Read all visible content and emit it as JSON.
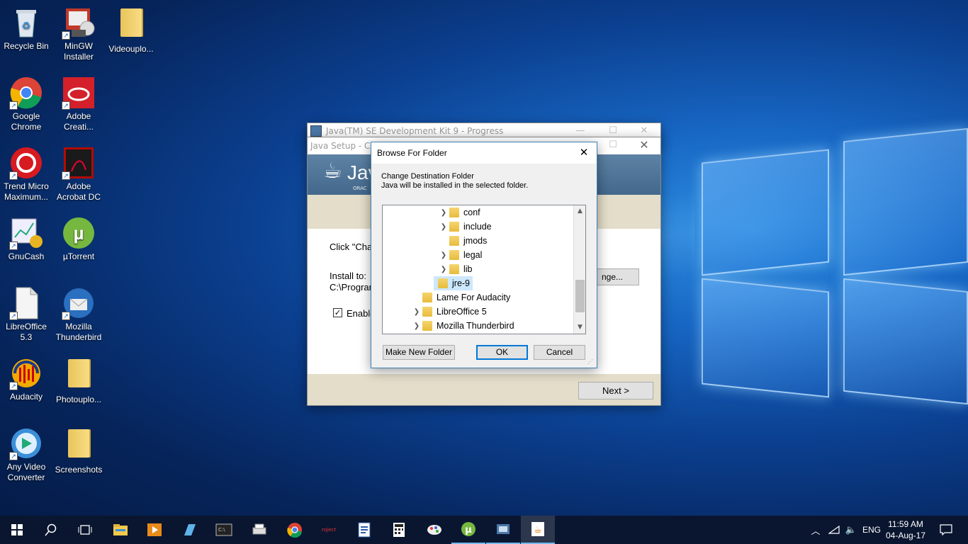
{
  "desktop": {
    "icons": [
      {
        "label1": "Recycle Bin",
        "label2": ""
      },
      {
        "label1": "MinGW",
        "label2": "Installer"
      },
      {
        "label1": "Videouplo...",
        "label2": ""
      },
      {
        "label1": "Google",
        "label2": "Chrome"
      },
      {
        "label1": "Adobe",
        "label2": "Creati..."
      },
      {
        "label1": "Trend Micro",
        "label2": "Maximum..."
      },
      {
        "label1": "Adobe",
        "label2": "Acrobat DC"
      },
      {
        "label1": "GnuCash",
        "label2": ""
      },
      {
        "label1": "µTorrent",
        "label2": ""
      },
      {
        "label1": "LibreOffice",
        "label2": "5.3"
      },
      {
        "label1": "Mozilla",
        "label2": "Thunderbird"
      },
      {
        "label1": "Audacity",
        "label2": ""
      },
      {
        "label1": "Photouplo...",
        "label2": ""
      },
      {
        "label1": "Any Video",
        "label2": "Converter"
      },
      {
        "label1": "Screenshots",
        "label2": ""
      }
    ]
  },
  "progress_window": {
    "title": "Java(TM) SE Development Kit 9 - Progress",
    "min": "—",
    "max": "☐",
    "close": "✕"
  },
  "setup_window": {
    "title": "Java Setup - Cus",
    "close": "✕",
    "logo_text": "Jav",
    "logo_sub": "ORAC",
    "click_text": "Click \"Cha",
    "install_to_label": "Install to:",
    "install_path": "C:\\Program",
    "change_button": "nge...",
    "enable_label": "Enable",
    "next_button": "Next >"
  },
  "browse_dialog": {
    "title": "Browse For Folder",
    "close": "✕",
    "heading": "Change Destination Folder",
    "subheading": "Java will be installed in the selected folder.",
    "tree": [
      {
        "label": "conf",
        "expandable": true,
        "level": 2
      },
      {
        "label": "include",
        "expandable": true,
        "level": 2
      },
      {
        "label": "jmods",
        "expandable": false,
        "level": 2
      },
      {
        "label": "legal",
        "expandable": true,
        "level": 2
      },
      {
        "label": "lib",
        "expandable": true,
        "level": 2
      },
      {
        "label": "jre-9",
        "expandable": false,
        "level": 1,
        "selected": true
      },
      {
        "label": "Lame For Audacity",
        "expandable": false,
        "level": 0
      },
      {
        "label": "LibreOffice 5",
        "expandable": true,
        "level": 0
      },
      {
        "label": "Mozilla Thunderbird",
        "expandable": true,
        "level": 0
      }
    ],
    "make_new_folder": "Make New Folder",
    "ok": "OK",
    "cancel": "Cancel"
  },
  "taskbar": {
    "language": "ENG",
    "time": "11:59 AM",
    "date": "04-Aug-17",
    "project_label": "roject"
  }
}
